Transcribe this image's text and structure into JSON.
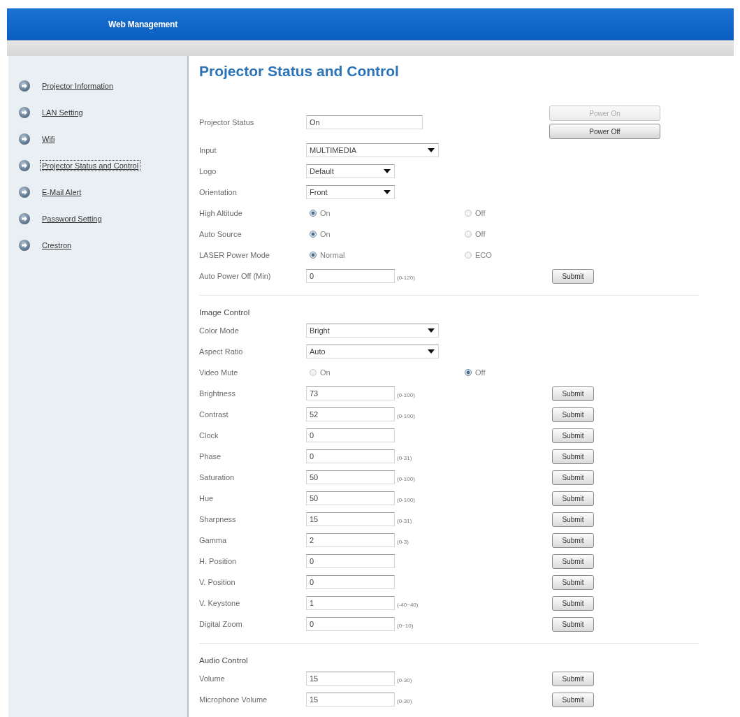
{
  "header": {
    "title": "Web Management"
  },
  "sidebar": {
    "items": [
      {
        "label": "Projector Information",
        "selected": false
      },
      {
        "label": "LAN Setting",
        "selected": false
      },
      {
        "label": "Wifi",
        "selected": false
      },
      {
        "label": "Projector Status and Control",
        "selected": true
      },
      {
        "label": "E-Mail Alert",
        "selected": false
      },
      {
        "label": "Password Setting",
        "selected": false
      },
      {
        "label": "Crestron",
        "selected": false
      }
    ]
  },
  "main": {
    "title": "Projector Status and Control",
    "sections": [
      {
        "rows": [
          {
            "kind": "status",
            "label": "Projector Status",
            "value": "On",
            "buttons": [
              {
                "label": "Power On",
                "disabled": true
              },
              {
                "label": "Power Off",
                "disabled": false
              }
            ]
          },
          {
            "kind": "select",
            "label": "Input",
            "value": "MULTIMEDIA",
            "wide": true
          },
          {
            "kind": "select",
            "label": "Logo",
            "value": "Default",
            "wide": false
          },
          {
            "kind": "select",
            "label": "Orientation",
            "value": "Front",
            "wide": false
          },
          {
            "kind": "radio",
            "label": "High Altitude",
            "options": [
              {
                "label": "On",
                "selected": true
              },
              {
                "label": "Off",
                "selected": false
              }
            ]
          },
          {
            "kind": "radio",
            "label": "Auto Source",
            "options": [
              {
                "label": "On",
                "selected": true
              },
              {
                "label": "Off",
                "selected": false
              }
            ]
          },
          {
            "kind": "radio",
            "label": "LASER Power Mode",
            "options": [
              {
                "label": "Normal",
                "selected": true
              },
              {
                "label": "ECO",
                "selected": false
              }
            ]
          },
          {
            "kind": "number",
            "label": "Auto Power Off (Min)",
            "value": "0",
            "range": "(0-120)",
            "button": "Submit"
          }
        ]
      },
      {
        "heading": "Image Control",
        "rows": [
          {
            "kind": "select",
            "label": "Color Mode",
            "value": "Bright",
            "wide": true
          },
          {
            "kind": "select",
            "label": "Aspect Ratio",
            "value": "Auto",
            "wide": true
          },
          {
            "kind": "radio",
            "label": "Video Mute",
            "options": [
              {
                "label": "On",
                "selected": false
              },
              {
                "label": "Off",
                "selected": true
              }
            ]
          },
          {
            "kind": "number",
            "label": "Brightness",
            "value": "73",
            "range": "(0-100)",
            "button": "Submit"
          },
          {
            "kind": "number",
            "label": "Contrast",
            "value": "52",
            "range": "(0-100)",
            "button": "Submit"
          },
          {
            "kind": "number",
            "label": "Clock",
            "value": "0",
            "button": "Submit"
          },
          {
            "kind": "number",
            "label": "Phase",
            "value": "0",
            "range": "(0-31)",
            "button": "Submit"
          },
          {
            "kind": "number",
            "label": "Saturation",
            "value": "50",
            "range": "(0-100)",
            "button": "Submit"
          },
          {
            "kind": "number",
            "label": "Hue",
            "value": "50",
            "range": "(0-100)",
            "button": "Submit"
          },
          {
            "kind": "number",
            "label": "Sharpness",
            "value": "15",
            "range": "(0-31)",
            "button": "Submit"
          },
          {
            "kind": "number",
            "label": "Gamma",
            "value": "2",
            "range": "(0-3)",
            "button": "Submit"
          },
          {
            "kind": "number",
            "label": "H. Position",
            "value": "0",
            "button": "Submit"
          },
          {
            "kind": "number",
            "label": "V. Position",
            "value": "0",
            "button": "Submit"
          },
          {
            "kind": "number",
            "label": "V. Keystone",
            "value": "1",
            "range": "(-40~40)",
            "button": "Submit"
          },
          {
            "kind": "number",
            "label": "Digital Zoom",
            "value": "0",
            "range": "(0~10)",
            "button": "Submit"
          }
        ]
      },
      {
        "heading": "Audio Control",
        "rows": [
          {
            "kind": "number",
            "label": "Volume",
            "value": "15",
            "range": "(0-30)",
            "button": "Submit"
          },
          {
            "kind": "number",
            "label": "Microphone Volume",
            "value": "15",
            "range": "(0-30)",
            "button": "Submit"
          }
        ]
      }
    ]
  }
}
